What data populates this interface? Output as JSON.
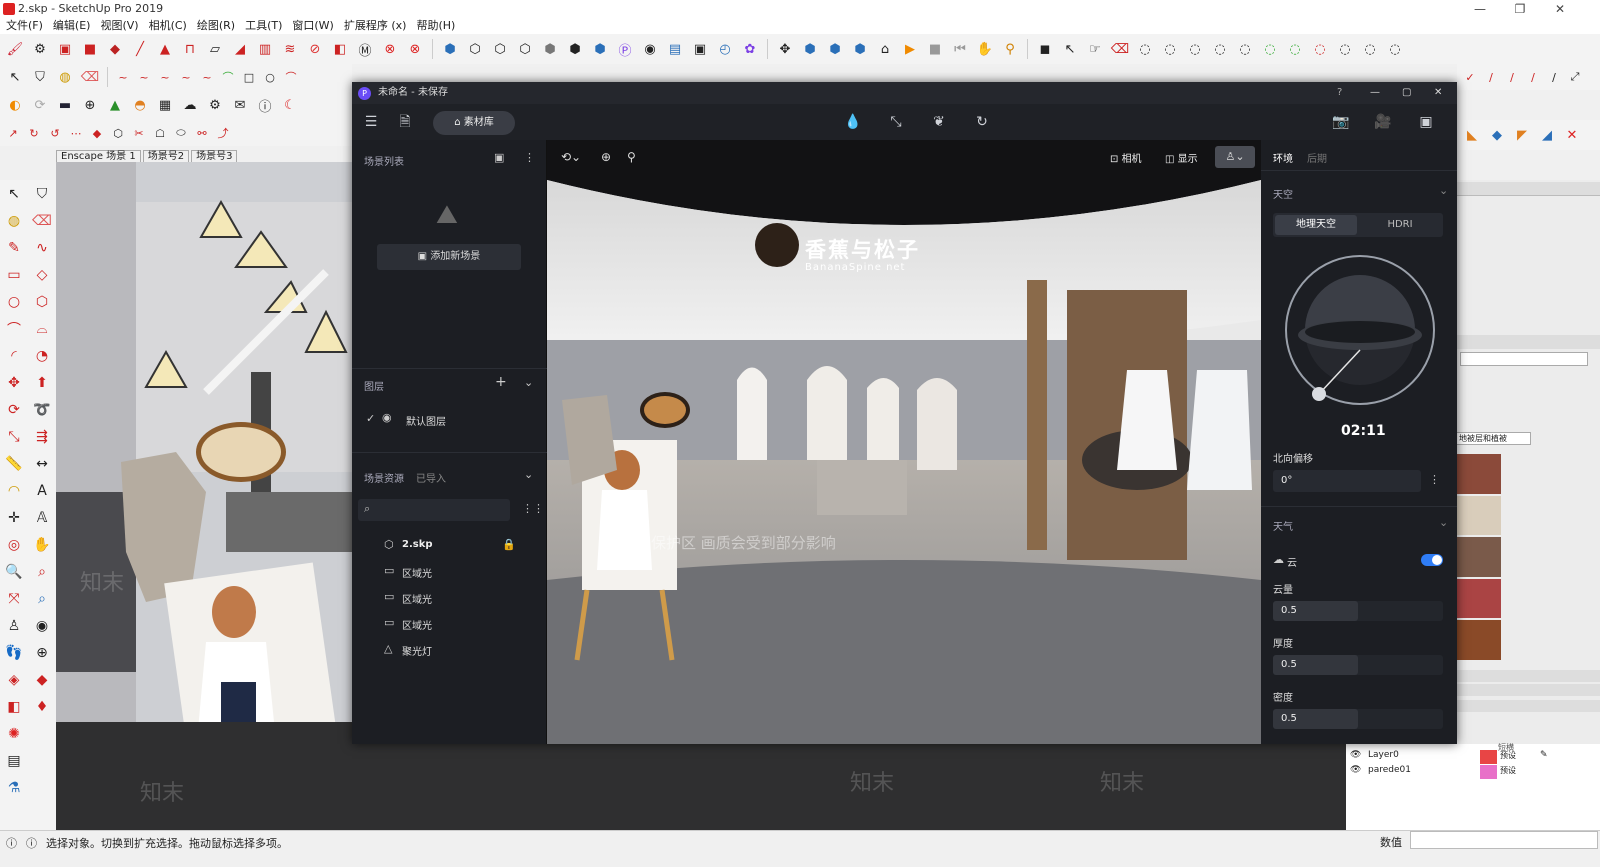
{
  "sketchup": {
    "title": "2.skp - SketchUp Pro 2019",
    "menu": [
      "文件(F)",
      "编辑(E)",
      "视图(V)",
      "相机(C)",
      "绘图(R)",
      "工具(T)",
      "窗口(W)",
      "扩展程序 (x)",
      "帮助(H)"
    ],
    "scene_tabs": [
      "Enscape 场景 1",
      "场景号2",
      "场景号3"
    ],
    "status_text": "选择对象。切换到扩充选择。拖动鼠标选择多项。",
    "measure_label": "数值",
    "layers": [
      {
        "name": "Layer0",
        "tag": "预设",
        "color": "#e84545"
      },
      {
        "name": "parede01",
        "tag": "预设",
        "color": "#e870c8"
      }
    ],
    "layers_header": "短横",
    "material_dropdown": "地被层和植被"
  },
  "d5": {
    "title": "未命名 - 未保存",
    "asset_button": "素材库",
    "scene_list_title": "场景列表",
    "add_scene_label": "添加新场景",
    "layers_title": "图层",
    "default_layer": "默认图层",
    "assets_title": "场景资源",
    "assets_tab_imported": "已导入",
    "asset_items": [
      {
        "icon": "cube-icon",
        "label": "2.skp"
      },
      {
        "icon": "rect-light-icon",
        "label": "区域光"
      },
      {
        "icon": "rect-light-icon",
        "label": "区域光"
      },
      {
        "icon": "rect-light-icon",
        "label": "区域光"
      },
      {
        "icon": "spotlight-icon",
        "label": "聚光灯"
      }
    ],
    "viewport": {
      "camera_label": "相机",
      "display_label": "显示",
      "watermark": "水印保护区 画质会受到部分影响",
      "shop_sign": "香蕉与松子",
      "shop_sign_sub": "BananaSpine net"
    },
    "right_panel": {
      "tabs": [
        "环境",
        "后期"
      ],
      "sky_title": "天空",
      "sky_modes": [
        "地理天空",
        "HDRI"
      ],
      "time": "02:11",
      "north_offset_label": "北向偏移",
      "north_offset_value": "0°",
      "weather_title": "天气",
      "cloud_label": "云",
      "cloud_amount_label": "云量",
      "cloud_amount": "0.5",
      "thickness_label": "厚度",
      "thickness": "0.5",
      "density_label": "密度",
      "density": "0.5"
    }
  },
  "watermark_text": "知末",
  "colors": {
    "accent": "#3b82f6",
    "d5_bg": "#1d1f24",
    "toggle_on": "#2f7df6"
  }
}
